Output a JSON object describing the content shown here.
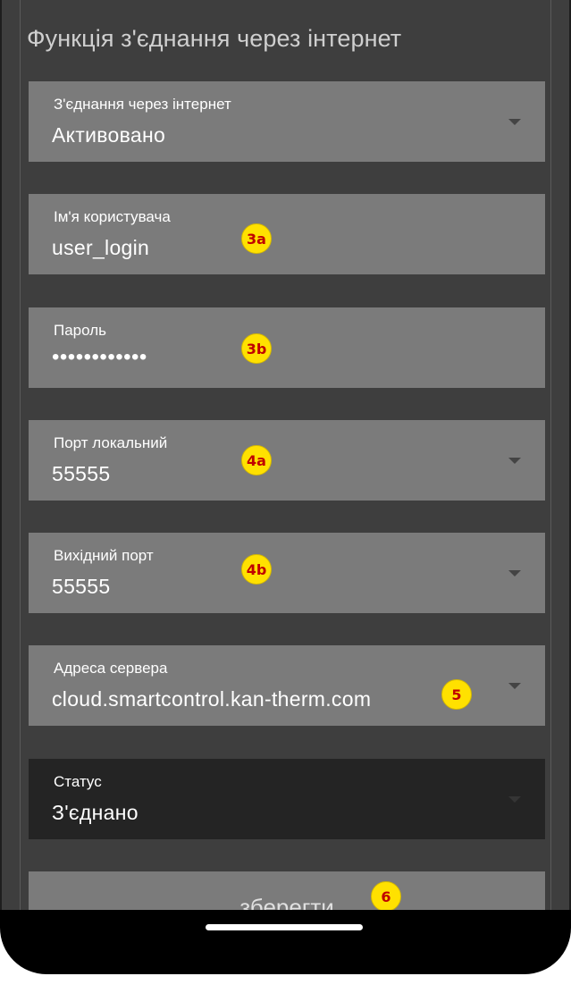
{
  "section": {
    "title": "Функція з'єднання через інтернет"
  },
  "fields": {
    "internet_connection": {
      "label": "З'єднання через інтернет",
      "value": "Активовано"
    },
    "username": {
      "label": "Ім'я користувача",
      "value": "user_login"
    },
    "password": {
      "label": "Пароль",
      "value": "••••••••••••"
    },
    "local_port": {
      "label": "Порт локальний",
      "value": "55555"
    },
    "outgoing_port": {
      "label": "Вихідний порт",
      "value": "55555"
    },
    "server_address": {
      "label": "Адреса сервера",
      "value": "cloud.smartcontrol.kan-therm.com"
    },
    "status": {
      "label": "Статус",
      "value": "З'єднано"
    }
  },
  "save_button": {
    "label": "зберегти"
  },
  "annotations": {
    "username": "3a",
    "password": "3b",
    "local_port": "4a",
    "outgoing_port": "4b",
    "server_address": "5",
    "save": "6"
  },
  "colors": {
    "background": "#3e3e3e",
    "field": "#7b7b7b",
    "status_field": "#242424",
    "badge_fill": "#ffe100",
    "badge_text": "#c00000"
  },
  "icons": {
    "dropdown": "chevron-down-icon"
  }
}
